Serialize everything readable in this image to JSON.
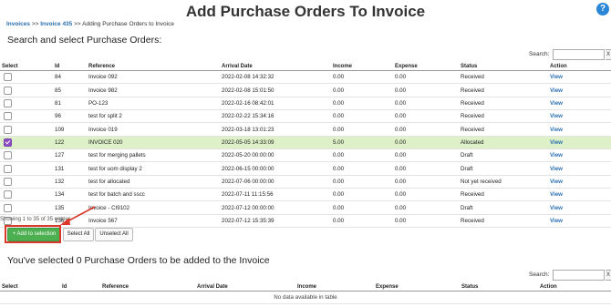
{
  "header": {
    "title": "Add Purchase Orders To Invoice",
    "help_icon": "?"
  },
  "breadcrumb": {
    "items": [
      "Invoices",
      "Invoice 435"
    ],
    "separator": ">>",
    "current": "Adding Purchase Orders to Invoice"
  },
  "top_section": {
    "heading": "Search and select Purchase Orders:",
    "search_label": "Search:",
    "search_value": "",
    "columns": [
      "Select",
      "Id",
      "Reference",
      "Arrival Date",
      "Income",
      "Expense",
      "Status",
      "Action"
    ],
    "rows": [
      {
        "checked": false,
        "id": "84",
        "reference": "Invoice 092",
        "arrival": "2022-02-08 14:32:32",
        "income": "0.00",
        "expense": "0.00",
        "status": "Received",
        "action": "View"
      },
      {
        "checked": false,
        "id": "85",
        "reference": "Invoice 982",
        "arrival": "2022-02-08 15:01:50",
        "income": "0.00",
        "expense": "0.00",
        "status": "Received",
        "action": "View"
      },
      {
        "checked": false,
        "id": "81",
        "reference": "PO-123",
        "arrival": "2022-02-16 08:42:01",
        "income": "0.00",
        "expense": "0.00",
        "status": "Received",
        "action": "View"
      },
      {
        "checked": false,
        "id": "96",
        "reference": "test for split 2",
        "arrival": "2022-02-22 15:34:16",
        "income": "0.00",
        "expense": "0.00",
        "status": "Received",
        "action": "View"
      },
      {
        "checked": false,
        "id": "109",
        "reference": "Invoice 019",
        "arrival": "2022-03-18 13:01:23",
        "income": "0.00",
        "expense": "0.00",
        "status": "Received",
        "action": "View"
      },
      {
        "checked": true,
        "id": "122",
        "reference": "INVOICE 020",
        "arrival": "2022-05-05 14:33:09",
        "income": "5.00",
        "expense": "0.00",
        "status": "Allocated",
        "action": "View"
      },
      {
        "checked": false,
        "id": "127",
        "reference": "test for merging pallets",
        "arrival": "2022-05-20 00:00:00",
        "income": "0.00",
        "expense": "0.00",
        "status": "Draft",
        "action": "View"
      },
      {
        "checked": false,
        "id": "131",
        "reference": "test for uom display 2",
        "arrival": "2022-06-15 00:00:00",
        "income": "0.00",
        "expense": "0.00",
        "status": "Draft",
        "action": "View"
      },
      {
        "checked": false,
        "id": "132",
        "reference": "test for allocated",
        "arrival": "2022-07-06 00:00:00",
        "income": "0.00",
        "expense": "0.00",
        "status": "Not yet received",
        "action": "View"
      },
      {
        "checked": false,
        "id": "134",
        "reference": "test for batch and sscc",
        "arrival": "2022-07-11 11:15:56",
        "income": "0.00",
        "expense": "0.00",
        "status": "Received",
        "action": "View"
      },
      {
        "checked": false,
        "id": "135",
        "reference": "Invoice - CI9102",
        "arrival": "2022-07-12 00:00:00",
        "income": "0.00",
        "expense": "0.00",
        "status": "Draft",
        "action": "View"
      },
      {
        "checked": false,
        "id": "136",
        "reference": "Invoice 567",
        "arrival": "2022-07-12 15:35:39",
        "income": "0.00",
        "expense": "0.00",
        "status": "Received",
        "action": "View"
      }
    ],
    "showing_text": "Showing 1 to 35 of 35 entries",
    "buttons": {
      "add": "+ Add to selection",
      "select_all": "Select All",
      "unselect_all": "Unselect All"
    }
  },
  "bottom_section": {
    "heading": "You've selected 0 Purchase Orders to be added to the Invoice",
    "search_label": "Search:",
    "search_value": "",
    "columns": [
      "Select",
      "Id",
      "Reference",
      "Arrival Date",
      "Income",
      "Expense",
      "Status",
      "Action"
    ],
    "empty_text": "No data available in table"
  },
  "colors": {
    "accent_green": "#4caf50",
    "selected_row": "#ddf0c7",
    "highlight_box": "#d9382a",
    "link": "#2a6fb0"
  }
}
